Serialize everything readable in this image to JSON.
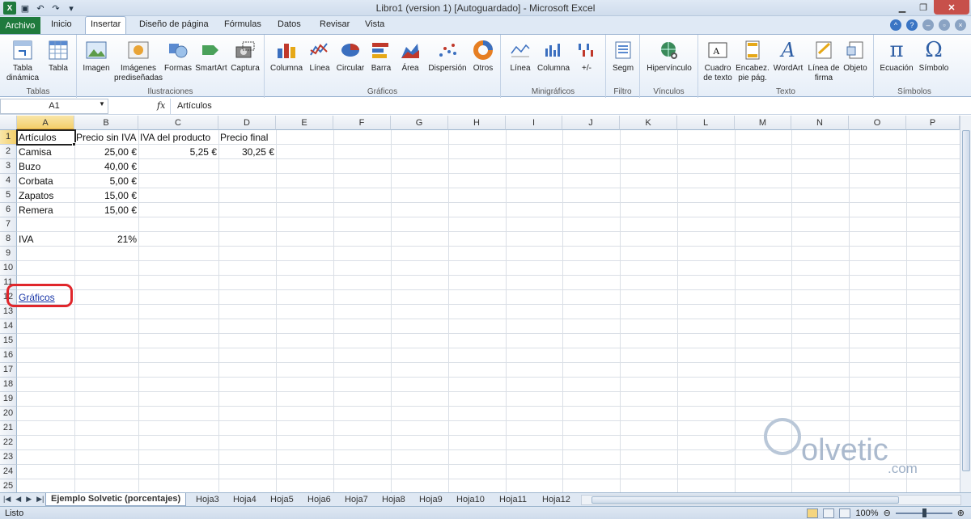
{
  "window": {
    "title": "Libro1 (version 1) [Autoguardado] - Microsoft Excel"
  },
  "tabs": {
    "file": "Archivo",
    "items": [
      "Inicio",
      "Insertar",
      "Diseño de página",
      "Fórmulas",
      "Datos",
      "Revisar",
      "Vista"
    ],
    "active": "Insertar"
  },
  "ribbon": {
    "groups": [
      "Tablas",
      "Ilustraciones",
      "Gráficos",
      "Minigráficos",
      "Filtro",
      "Vínculos",
      "Texto",
      "Símbolos"
    ],
    "buttons": {
      "tabla_dinamica": "Tabla dinámica",
      "tabla": "Tabla",
      "imagen": "Imagen",
      "imagenes_pred": "Imágenes prediseñadas",
      "formas": "Formas",
      "smartart": "SmartArt",
      "captura": "Captura",
      "columna": "Columna",
      "linea": "Línea",
      "circular": "Circular",
      "barra": "Barra",
      "area": "Área",
      "dispersion": "Dispersión",
      "otros": "Otros",
      "mini_linea": "Línea",
      "mini_columna": "Columna",
      "mini_pm": "+/-",
      "segm": "Segm",
      "hipervinculo": "Hipervínculo",
      "cuadro_texto": "Cuadro de texto",
      "encabez": "Encabez. pie pág.",
      "wordart": "WordArt",
      "linea_firma": "Línea de firma",
      "objeto": "Objeto",
      "ecuacion": "Ecuación",
      "simbolo": "Símbolo"
    }
  },
  "formula_bar": {
    "name_box": "A1",
    "fx": "fx",
    "content": "Artículos"
  },
  "columns": [
    "A",
    "B",
    "C",
    "D",
    "E",
    "F",
    "G",
    "H",
    "I",
    "J",
    "K",
    "L",
    "M",
    "N",
    "O",
    "P"
  ],
  "rows": [
    "1",
    "2",
    "3",
    "4",
    "5",
    "6",
    "7",
    "8",
    "9",
    "10",
    "11",
    "12",
    "13",
    "14",
    "15",
    "16",
    "17",
    "18",
    "19",
    "20",
    "21",
    "22",
    "23",
    "24",
    "25"
  ],
  "cells": {
    "A1": "Artículos",
    "B1": "Precio sin IVA",
    "C1": "IVA del producto",
    "D1": "Precio final",
    "A2": "Camisa",
    "B2": "25,00 €",
    "C2": "5,25 €",
    "D2": "30,25 €",
    "A3": "Buzo",
    "B3": "40,00 €",
    "A4": "Corbata",
    "B4": "5,00 €",
    "A5": "Zapatos",
    "B5": "15,00 €",
    "A6": "Remera",
    "B6": "15,00 €",
    "A8": "IVA",
    "B8": "21%",
    "A12": "Gráficos"
  },
  "sheets": {
    "tabs": [
      "Ejemplo Solvetic (porcentajes)",
      "Hoja3",
      "Hoja4",
      "Hoja5",
      "Hoja6",
      "Hoja7",
      "Hoja8",
      "Hoja9",
      "Hoja10",
      "Hoja11",
      "Hoja12"
    ],
    "active": "Ejemplo Solvetic (porcentajes)"
  },
  "status": {
    "text": "Listo",
    "zoom": "100%"
  },
  "watermark": {
    "brand": "olvetic",
    "tld": ".com"
  }
}
